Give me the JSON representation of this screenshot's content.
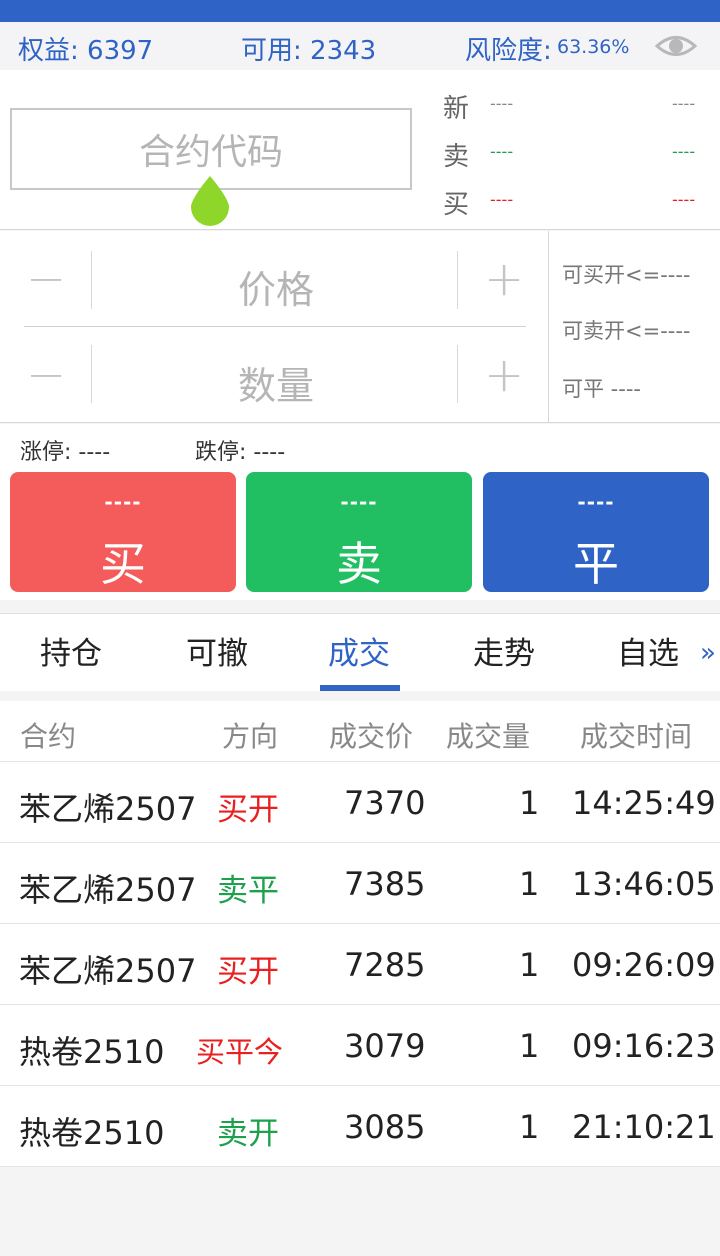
{
  "colors": {
    "primary": "#2f64c6",
    "buy": "#f45b5b",
    "sell": "#21bf62",
    "close": "#2f64c6",
    "buy_text": "#e8201f",
    "sell_text": "#1da14c"
  },
  "summary": {
    "equity": "权益: 6397",
    "available": "可用: 2343",
    "risk_label": "风险度:",
    "risk_value": "63.36%"
  },
  "quote": {
    "code_placeholder": "合约代码",
    "rows": [
      {
        "label": "新",
        "left": "----",
        "right": "----",
        "color": "#888888"
      },
      {
        "label": "卖",
        "left": "----",
        "right": "----",
        "color": "#1da14c"
      },
      {
        "label": "买",
        "left": "----",
        "right": "----",
        "color": "#e8201f"
      }
    ]
  },
  "order": {
    "minus": "−",
    "plus": "+",
    "price_placeholder": "价格",
    "qty_placeholder": "数量",
    "can_buy_open": "可买开<=----",
    "can_sell_open": "可卖开<=----",
    "can_close": "可平  ----"
  },
  "limits": {
    "up": "涨停: ----",
    "down": "跌停: ----"
  },
  "buttons": {
    "buy": {
      "price": "----",
      "label": "买"
    },
    "sell": {
      "price": "----",
      "label": "卖"
    },
    "close": {
      "price": "----",
      "label": "平"
    }
  },
  "tabs": {
    "items": [
      "持仓",
      "可撤",
      "成交",
      "走势",
      "自选"
    ],
    "active_index": 2,
    "more": "»"
  },
  "trades": {
    "headers": [
      "合约",
      "方向",
      "成交价",
      "成交量",
      "成交时间"
    ],
    "rows": [
      {
        "contract": "苯乙烯2507",
        "direction": "买开",
        "dir_color": "#e8201f",
        "price": "7370",
        "qty": "1",
        "time": "14:25:49"
      },
      {
        "contract": "苯乙烯2507",
        "direction": "卖平",
        "dir_color": "#1da14c",
        "price": "7385",
        "qty": "1",
        "time": "13:46:05"
      },
      {
        "contract": "苯乙烯2507",
        "direction": "买开",
        "dir_color": "#e8201f",
        "price": "7285",
        "qty": "1",
        "time": "09:26:09"
      },
      {
        "contract": "热卷2510",
        "direction": "买平今",
        "dir_color": "#e8201f",
        "price": "3079",
        "qty": "1",
        "time": "09:16:23"
      },
      {
        "contract": "热卷2510",
        "direction": "卖开",
        "dir_color": "#1da14c",
        "price": "3085",
        "qty": "1",
        "time": "21:10:21"
      }
    ]
  },
  "icons": {
    "eye": "eye-icon",
    "drop": "drag-handle-icon"
  }
}
